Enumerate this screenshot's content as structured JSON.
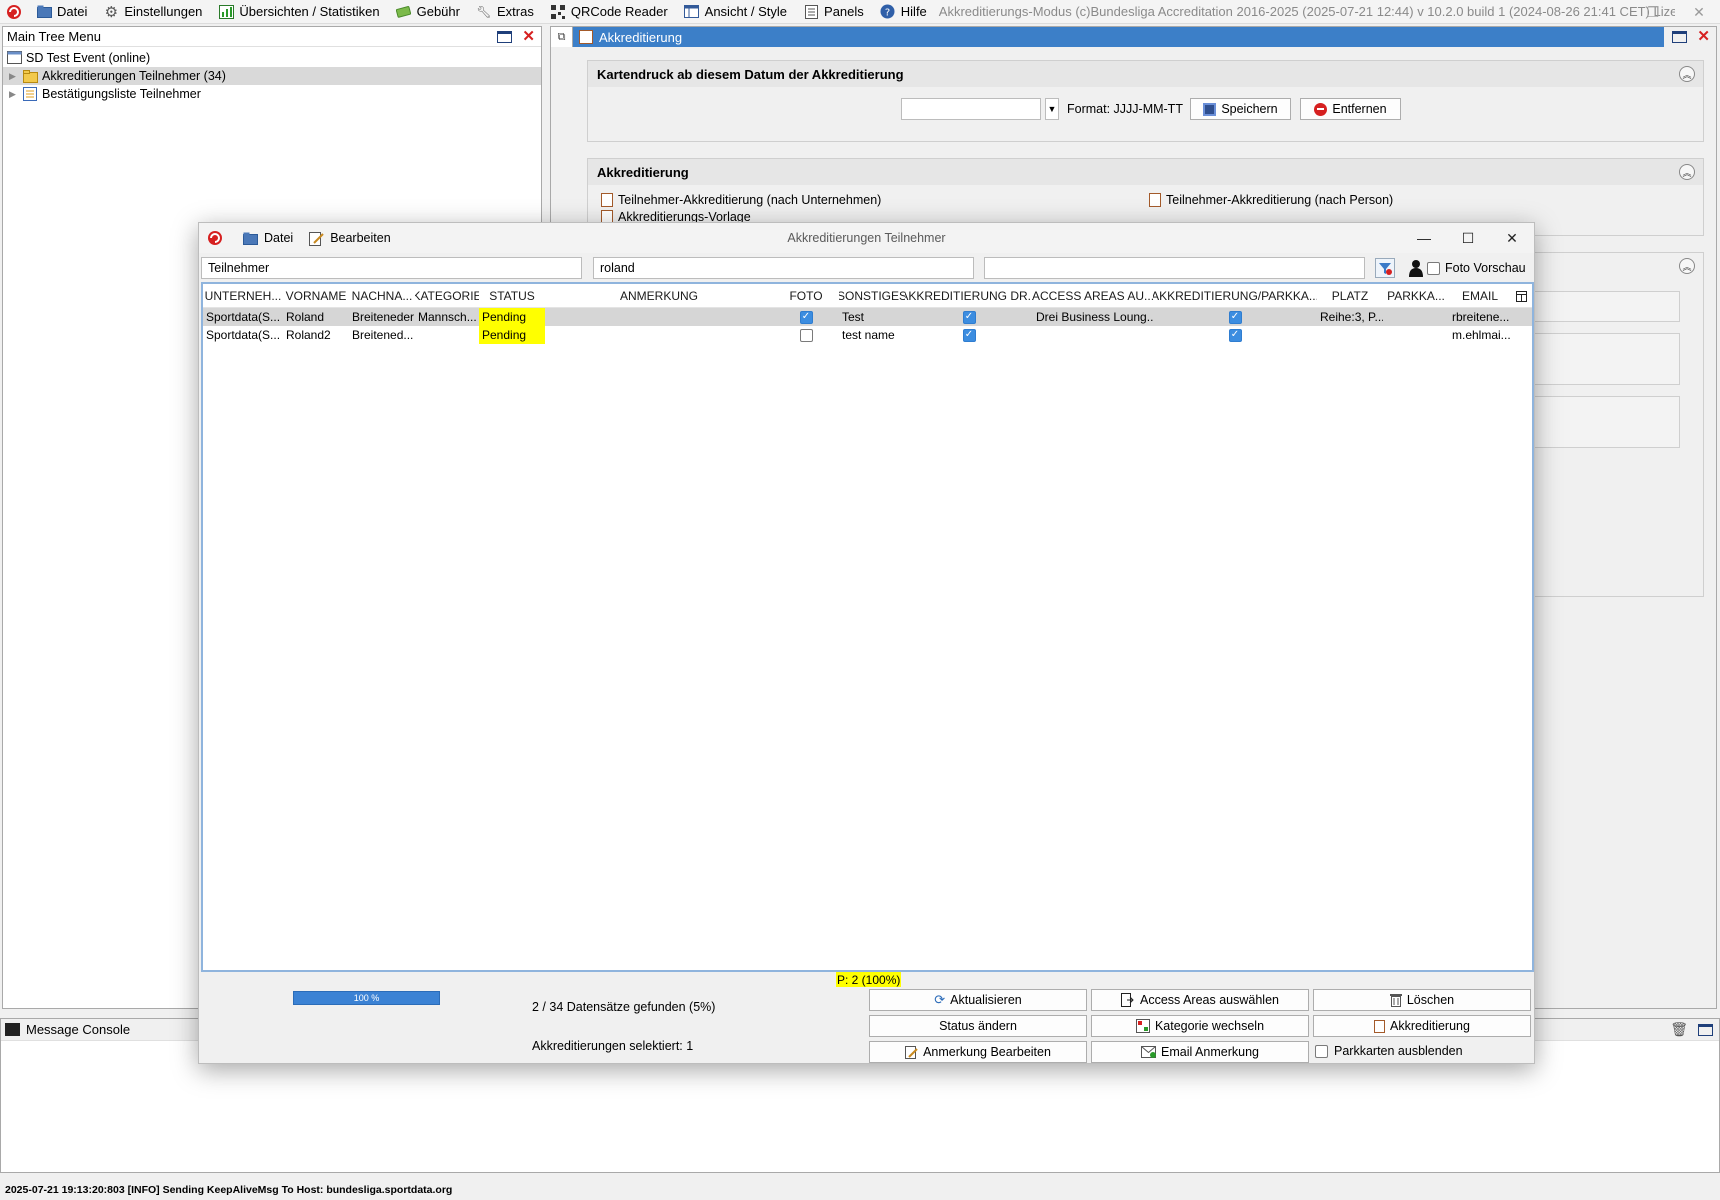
{
  "menubar": {
    "items": [
      {
        "label": "Datei",
        "icon": "folder-icon"
      },
      {
        "label": "Einstellungen",
        "icon": "gear-icon"
      },
      {
        "label": "Übersichten / Statistiken",
        "icon": "chart-icon"
      },
      {
        "label": "Gebühr",
        "icon": "money-icon"
      },
      {
        "label": "Extras",
        "icon": "wrench-icon"
      },
      {
        "label": "QRCode Reader",
        "icon": "qrcode-icon"
      },
      {
        "label": "Ansicht / Style",
        "icon": "layout-icon"
      },
      {
        "label": "Panels",
        "icon": "panel-icon"
      },
      {
        "label": "Hilfe",
        "icon": "help-icon"
      }
    ],
    "app_title": "Akkreditierungs-Modus (c)Bundesliga Accreditation 2016-2025 (2025-07-21 12:44) v 10.2.0 build 1 (2024-08-26 21:41 CET) Lizenz: SDI..."
  },
  "tree": {
    "title": "Main Tree Menu",
    "items": [
      {
        "label": "SD Test Event (online)"
      },
      {
        "label": "Akkreditierungen Teilnehmer (34)"
      },
      {
        "label": "Bestätigungsliste Teilnehmer"
      }
    ]
  },
  "akk": {
    "title": "Akkreditierung",
    "kartendruck_title": "Kartendruck ab diesem Datum der Akkreditierung",
    "date_value": "",
    "format_label": "Format: JJJJ-MM-TT",
    "save_label": "Speichern",
    "remove_label": "Entfernen",
    "section_title": "Akkreditierung",
    "link_company": "Teilnehmer-Akkreditierung (nach Unternehmen)",
    "link_person": "Teilnehmer-Akkreditierung (nach Person)",
    "link_template": "Akkreditierungs-Vorlage"
  },
  "console": {
    "title": "Message Console",
    "status_line": "2025-07-21 19:13:20:803 [INFO] Sending KeepAliveMsg To Host: bundesliga.sportdata.org"
  },
  "dialog": {
    "title": "Akkreditierungen Teilnehmer",
    "menu_datei": "Datei",
    "menu_bearbeiten": "Bearbeiten",
    "filter1": "Teilnehmer",
    "filter2": "roland",
    "filter3": "",
    "foto_vorschau": "Foto Vorschau",
    "columns": [
      "UNTERNEH...",
      "VORNAME",
      "NACHNA...",
      "KATEGORIE",
      "STATUS",
      "ANMERKUNG",
      "FOTO",
      "SONSTIGES",
      "AKKREDITIERUNG DR...",
      "ACCESS AREAS AU...",
      "AKKREDITIERUNG/PARKKA...",
      "PLATZ",
      "PARKKA...",
      "EMAIL"
    ],
    "rows": [
      {
        "unternehmen": "Sportdata(S...",
        "vorname": "Roland",
        "nachname": "Breiteneder",
        "kategorie": "Mannsch...",
        "status": "Pending",
        "anmerkung": "",
        "foto": true,
        "sonstiges": "Test",
        "akk_druck": true,
        "access_areas": "Drei Business Loung...",
        "akk_parkkarte": true,
        "platz": "Reihe:3, P...",
        "parkkarte": "",
        "email": "rbreitene..."
      },
      {
        "unternehmen": "Sportdata(S...",
        "vorname": "Roland2",
        "nachname": "Breitened...",
        "kategorie": "",
        "status": "Pending",
        "anmerkung": "",
        "foto": false,
        "sonstiges": "test name",
        "akk_druck": true,
        "access_areas": "",
        "akk_parkkarte": true,
        "platz": "",
        "parkkarte": "",
        "email": "m.ehlmai..."
      }
    ],
    "pending_summary": "P: 2 (100%)",
    "progress_label": "100 %",
    "progress_value": 1.0,
    "found_text": "2 / 34 Datensätze gefunden (5%)",
    "selected_text": "Akkreditierungen selektiert: 1",
    "buttons": {
      "aktualisieren": "Aktualisieren",
      "access_areas": "Access Areas auswählen",
      "loeschen": "Löschen",
      "status_aendern": "Status ändern",
      "kategorie": "Kategorie wechseln",
      "akkreditierung": "Akkreditierung",
      "anmerkung": "Anmerkung Bearbeiten",
      "email": "Email Anmerkung",
      "parkkarten": "Parkkarten ausblenden"
    }
  },
  "colors": {
    "accent": "#3c7fc8",
    "pending": "#ffff00",
    "checkbox": "#3c8de0",
    "close_red": "#d62020"
  }
}
